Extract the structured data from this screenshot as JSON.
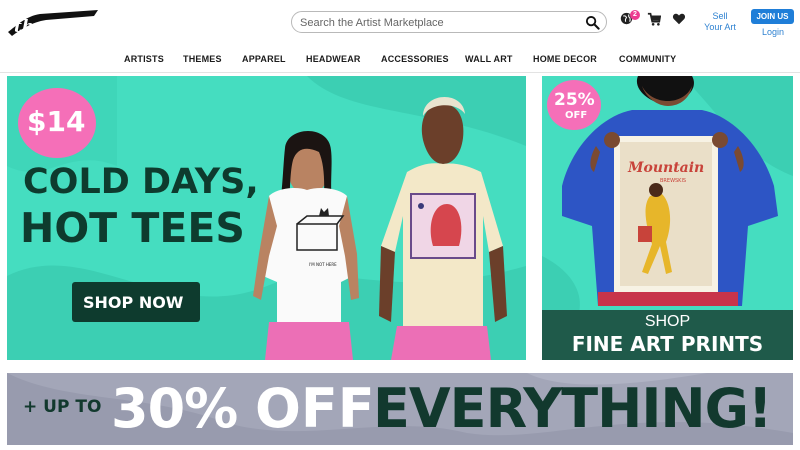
{
  "header": {
    "logo_text": "threadless",
    "search_placeholder": "Search the Artist Marketplace",
    "notification_count": "2",
    "sell_line1": "Sell",
    "sell_line2": "Your Art",
    "join_label": "JOIN US",
    "login_label": "Login",
    "icons": [
      "globe-icon",
      "cart-icon",
      "heart-icon",
      "search-icon"
    ]
  },
  "nav": {
    "items": [
      "ARTISTS",
      "THEMES",
      "APPAREL",
      "HEADWEAR",
      "ACCESSORIES",
      "WALL ART",
      "HOME DECOR",
      "COMMUNITY"
    ]
  },
  "hero": {
    "price": "$14",
    "headline_1": "COLD DAYS,",
    "headline_2": "HOT TEES",
    "cta": "SHOP NOW",
    "shirt_caption": "I'M NOT HERE"
  },
  "side_promo": {
    "discount": "25%",
    "discount_label": "OFF",
    "poster_title": "Mountain",
    "poster_subtitle": "BREWSKIS",
    "line_1": "SHOP",
    "line_2": "FINE ART PRINTS"
  },
  "banner": {
    "prefix": "+ UP TO",
    "amount": "30%",
    "off": "OFF",
    "everything": "EVERYTHING!"
  },
  "colors": {
    "teal": "#45ddc0",
    "dark_green": "#0e3b2e",
    "pink": "#f56fb8",
    "link_blue": "#2f82d1",
    "join_blue": "#1f7ed8"
  }
}
